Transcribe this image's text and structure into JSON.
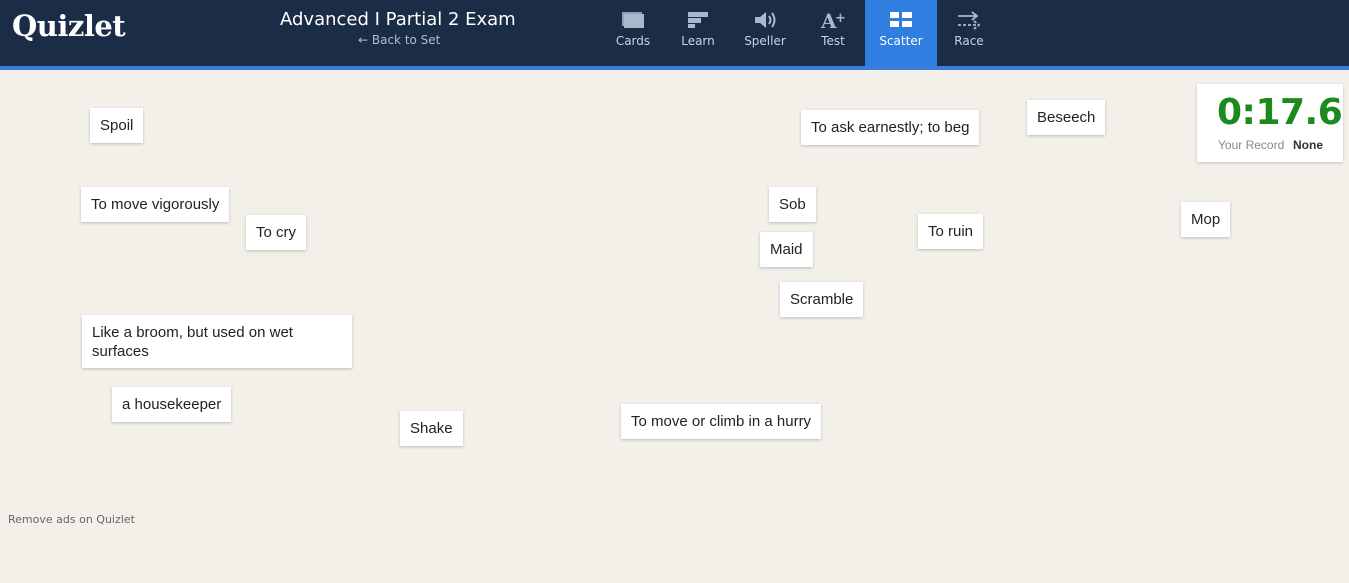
{
  "header": {
    "logo": "Quizlet",
    "set_title": "Advanced I Partial 2 Exam",
    "back_link": "← Back to Set",
    "nav": [
      {
        "label": "Cards",
        "icon": "cards-icon"
      },
      {
        "label": "Learn",
        "icon": "learn-icon"
      },
      {
        "label": "Speller",
        "icon": "speaker-icon"
      },
      {
        "label": "Test",
        "icon": "test-icon"
      },
      {
        "label": "Scatter",
        "icon": "scatter-icon",
        "active": true
      },
      {
        "label": "Race",
        "icon": "race-icon"
      }
    ]
  },
  "record": {
    "timer": "0:17.6",
    "label": "Your Record",
    "value": "None"
  },
  "cards": [
    "Spoil",
    "To move vigorously",
    "To cry",
    "Like a broom, but used on wet surfaces",
    "a housekeeper",
    "Shake",
    "To move or climb in a hurry",
    "To ask earnestly; to beg",
    "Beseech",
    "Sob",
    "Maid",
    "To ruin",
    "Scramble",
    "Mop"
  ],
  "footer": {
    "remove_ads": "Remove ads on Quizlet"
  },
  "colors": {
    "header_bg": "#1b2d46",
    "accent": "#2f7ee0",
    "timer": "#1d8a1d",
    "page_bg": "#f3f0ea"
  }
}
